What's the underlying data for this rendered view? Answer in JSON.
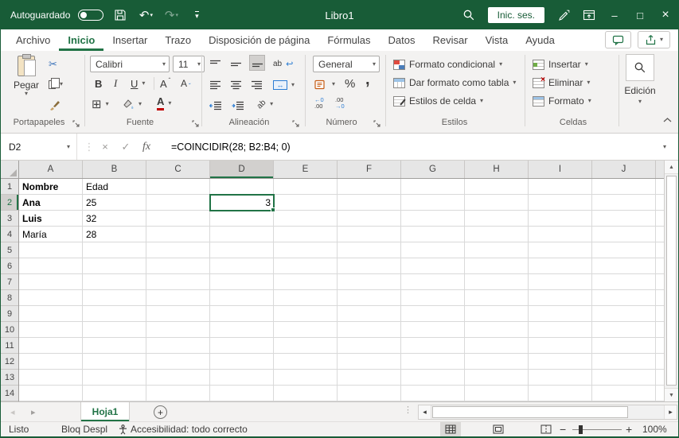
{
  "titlebar": {
    "autosave_label": "Autoguardado",
    "title": "Libro1",
    "signin_label": "Inic. ses."
  },
  "tabs": [
    {
      "label": "Archivo"
    },
    {
      "label": "Inicio"
    },
    {
      "label": "Insertar"
    },
    {
      "label": "Trazo"
    },
    {
      "label": "Disposición de página"
    },
    {
      "label": "Fórmulas"
    },
    {
      "label": "Datos"
    },
    {
      "label": "Revisar"
    },
    {
      "label": "Vista"
    },
    {
      "label": "Ayuda"
    }
  ],
  "active_tab": "Inicio",
  "ribbon": {
    "clipboard": {
      "label": "Portapapeles",
      "paste": "Pegar"
    },
    "font": {
      "label": "Fuente",
      "name": "Calibri",
      "size": "11",
      "bold": "B",
      "italic": "I",
      "underline": "U",
      "grow": "A",
      "shrink": "A",
      "color": "A"
    },
    "alignment": {
      "label": "Alineación",
      "wrap": "ab",
      "orientation": "ab"
    },
    "number": {
      "label": "Número",
      "format": "General",
      "percent": "%",
      "comma": ",",
      "inc_dec_top": "←0",
      "inc_dec_bottom": ".00",
      "dec_dec_top": ".00",
      "dec_dec_bottom": "→0"
    },
    "styles": {
      "label": "Estilos",
      "items": [
        "Formato condicional",
        "Dar formato como tabla",
        "Estilos de celda"
      ]
    },
    "cells": {
      "label": "Celdas",
      "items": [
        "Insertar",
        "Eliminar",
        "Formato"
      ]
    },
    "editing": {
      "label": "Edición"
    }
  },
  "formula_bar": {
    "name_box": "D2",
    "fx_label": "fx",
    "formula": "=COINCIDIR(28; B2:B4; 0)"
  },
  "grid": {
    "columns": [
      "A",
      "B",
      "C",
      "D",
      "E",
      "F",
      "G",
      "H",
      "I",
      "J"
    ],
    "rows": [
      "1",
      "2",
      "3",
      "4",
      "5",
      "6",
      "7",
      "8",
      "9",
      "10",
      "11",
      "12",
      "13",
      "14"
    ],
    "selected_cell": "D2",
    "cells": {
      "A1": "Nombre",
      "B1": "Edad",
      "A2": "Ana",
      "B2": "25",
      "D2": "3",
      "A3": "Luis",
      "B3": "32",
      "A4": "María",
      "B4": "28"
    }
  },
  "sheets": {
    "active": "Hoja1",
    "add_label": "+"
  },
  "status_bar": {
    "mode": "Listo",
    "scroll_lock": "Bloq Despl",
    "accessibility": "Accesibilidad: todo correcto",
    "zoom": "100%"
  },
  "colors": {
    "titlebar_green": "#185C37",
    "accent_green": "#217346",
    "font_color_red": "#c00000"
  }
}
